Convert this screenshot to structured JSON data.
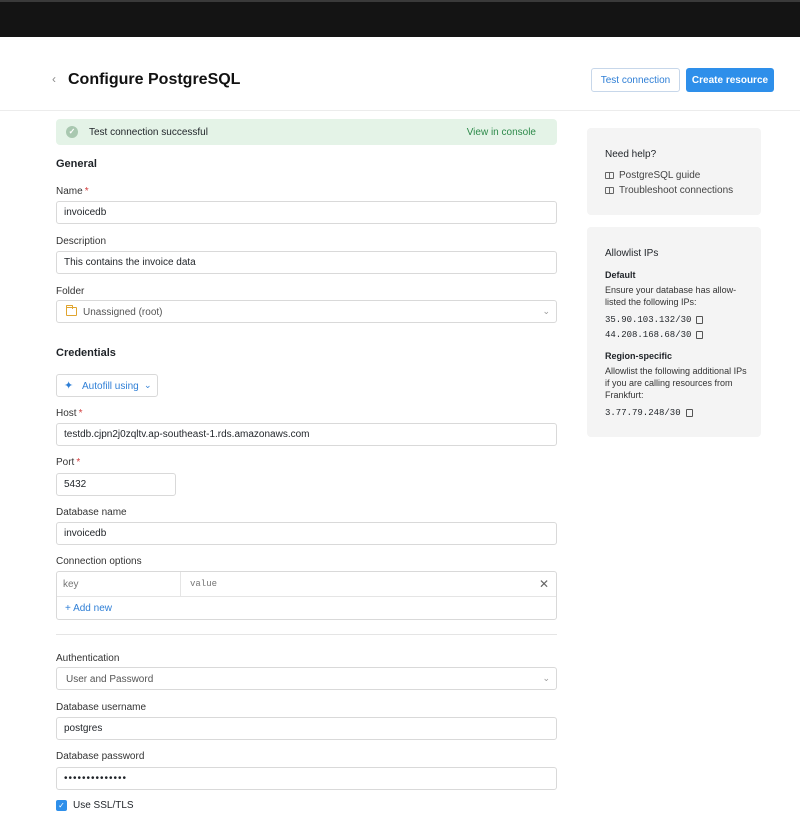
{
  "header": {
    "back_icon": "chevron-left-icon",
    "title": "Configure PostgreSQL",
    "test_connection": "Test connection",
    "create_resource": "Create resource"
  },
  "alert": {
    "message": "Test connection successful",
    "link": "View in console",
    "icon": "check-circle-icon"
  },
  "general": {
    "heading": "General",
    "name_label": "Name",
    "name_value": "invoicedb",
    "description_label": "Description",
    "description_value": "This contains the invoice data",
    "folder_label": "Folder",
    "folder_value": "Unassigned (root)"
  },
  "credentials": {
    "heading": "Credentials",
    "autofill": "Autofill using",
    "host_label": "Host",
    "host_value": "testdb.cjpn2j0zqltv.ap-southeast-1.rds.amazonaws.com",
    "port_label": "Port",
    "port_value": "5432",
    "dbname_label": "Database name",
    "dbname_value": "invoicedb",
    "options_label": "Connection options",
    "key_placeholder": "key",
    "value_placeholder": "value",
    "add_new": "+ Add new"
  },
  "auth": {
    "label": "Authentication",
    "value": "User and Password",
    "username_label": "Database username",
    "username_value": "postgres",
    "password_label": "Database password",
    "password_value": "••••••••••••••",
    "ssl_label": "Use SSL/TLS",
    "ssl_checked": true
  },
  "help": {
    "heading": "Need help?",
    "links": [
      "PostgreSQL guide",
      "Troubleshoot connections"
    ]
  },
  "allowlist": {
    "heading": "Allowlist IPs",
    "default_heading": "Default",
    "default_text": "Ensure your database has allow-listed the following IPs:",
    "default_ips": [
      "35.90.103.132/30",
      "44.208.168.68/30"
    ],
    "region_heading": "Region-specific",
    "region_text": "Allowlist the following additional IPs if you are calling resources from Frankfurt:",
    "region_ips": [
      "3.77.79.248/30"
    ]
  },
  "colors": {
    "accent": "#2e8fea",
    "success_bg": "#e4f3e7",
    "success_text": "#2d8a4a",
    "required": "#d23c3c"
  }
}
